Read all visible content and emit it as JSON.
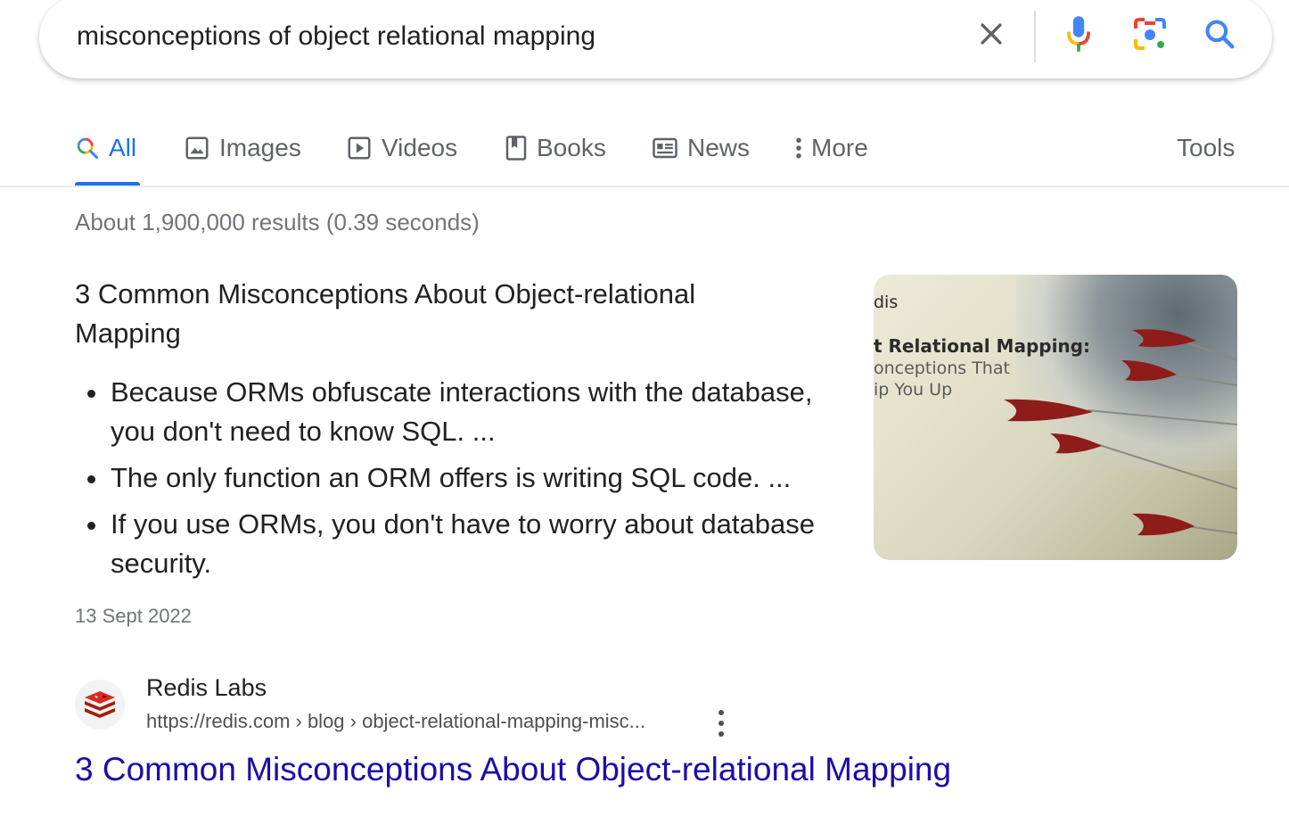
{
  "search": {
    "query": "misconceptions of object relational mapping"
  },
  "tabs": [
    {
      "label": "All",
      "icon": "search-icon",
      "active": true
    },
    {
      "label": "Images",
      "icon": "image-icon"
    },
    {
      "label": "Videos",
      "icon": "play-icon"
    },
    {
      "label": "Books",
      "icon": "book-icon"
    },
    {
      "label": "News",
      "icon": "news-icon"
    },
    {
      "label": "More",
      "icon": "more-vert-icon"
    }
  ],
  "tools_label": "Tools",
  "stats": "About 1,900,000 results (0.39 seconds)",
  "featured_snippet": {
    "title": "3 Common Misconceptions About Object-relational Mapping",
    "bullets": [
      "Because ORMs obfuscate interactions with the database, you don't need to know SQL. ...",
      "The only function an ORM offers is writing SQL code. ...",
      "If you use ORMs, you don't have to worry about database security."
    ],
    "date": "13 Sept 2022",
    "thumbnail_lines": [
      "dis",
      "t Relational Mapping:",
      "onceptions That",
      "ip You Up"
    ]
  },
  "result": {
    "site_name": "Redis Labs",
    "url": "https://redis.com › blog › object-relational-mapping-misc...",
    "title": "3 Common Misconceptions About Object-relational Mapping"
  },
  "colors": {
    "link": "#1a0dab",
    "active_tab": "#1a73e8",
    "secondary_text": "#70757a"
  }
}
